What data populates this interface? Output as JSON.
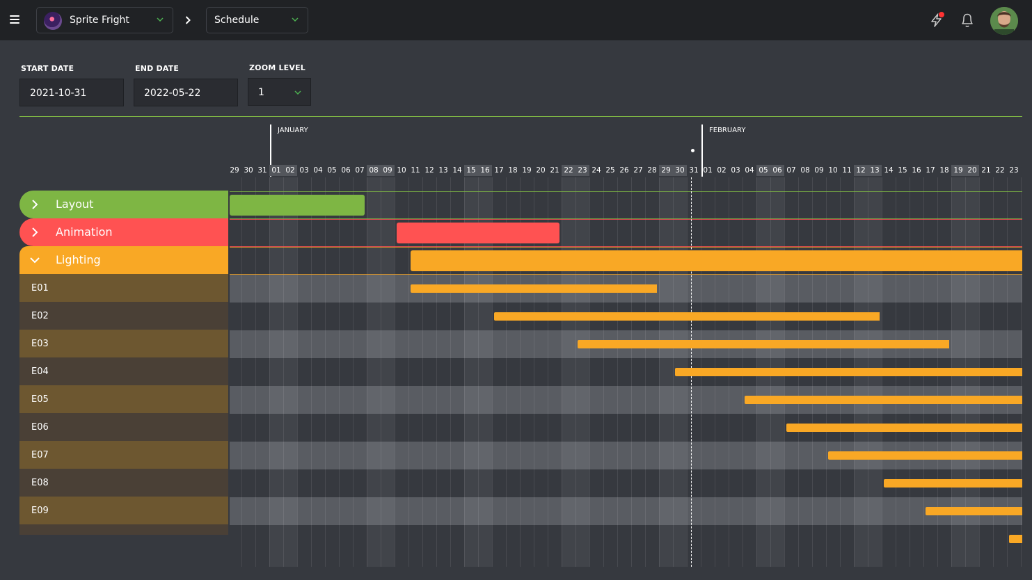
{
  "header": {
    "project": {
      "name": "Sprite Fright"
    },
    "view": {
      "name": "Schedule"
    }
  },
  "filters": {
    "start_date": {
      "label": "START DATE",
      "value": "2021-10-31"
    },
    "end_date": {
      "label": "END DATE",
      "value": "2022-05-22"
    },
    "zoom": {
      "label": "ZOOM LEVEL",
      "value": "1"
    }
  },
  "timeline": {
    "months": [
      {
        "name": "JANUARY",
        "start_index": 3
      },
      {
        "name": "FEBRUARY",
        "start_index": 34
      }
    ],
    "days": [
      "29",
      "30",
      "31",
      "01",
      "02",
      "03",
      "04",
      "05",
      "06",
      "07",
      "08",
      "09",
      "10",
      "11",
      "12",
      "13",
      "14",
      "15",
      "16",
      "17",
      "18",
      "19",
      "20",
      "21",
      "22",
      "23",
      "24",
      "25",
      "26",
      "27",
      "28",
      "29",
      "30",
      "31",
      "01",
      "02",
      "03",
      "04",
      "05",
      "06",
      "07",
      "08",
      "09",
      "10",
      "11",
      "12",
      "13",
      "14",
      "15",
      "16",
      "17",
      "18",
      "19",
      "20",
      "21",
      "22",
      "23"
    ],
    "weekend_indices": [
      3,
      4,
      10,
      11,
      17,
      18,
      24,
      25,
      31,
      32,
      38,
      39,
      45,
      46,
      52,
      53
    ],
    "today_index": 33.3
  },
  "colors": {
    "layout": "#7eb644",
    "animation": "#ff5252",
    "lighting": "#f9a825",
    "sub_row_light": "#6d5730",
    "sub_row_dark": "#4a4036"
  },
  "tasks": [
    {
      "id": "layout",
      "name": "Layout",
      "type": "group",
      "state": "collapsed",
      "color": "#7eb644",
      "bar": {
        "start": 0,
        "end": 9.7
      }
    },
    {
      "id": "animation",
      "name": "Animation",
      "type": "group",
      "state": "collapsed",
      "color": "#ff5252",
      "bar": {
        "start": 12,
        "end": 23.7
      }
    },
    {
      "id": "lighting",
      "name": "Lighting",
      "type": "group",
      "state": "expanded",
      "color": "#f9a825",
      "bar": {
        "start": 13,
        "end": 57
      }
    },
    {
      "id": "e01",
      "name": "E01",
      "type": "sub",
      "bar": {
        "start": 13,
        "end": 30.7
      }
    },
    {
      "id": "e02",
      "name": "E02",
      "type": "sub",
      "bar": {
        "start": 19,
        "end": 46.7
      }
    },
    {
      "id": "e03",
      "name": "E03",
      "type": "sub",
      "bar": {
        "start": 25,
        "end": 51.7
      }
    },
    {
      "id": "e04",
      "name": "E04",
      "type": "sub",
      "bar": {
        "start": 32,
        "end": 57
      }
    },
    {
      "id": "e05",
      "name": "E05",
      "type": "sub",
      "bar": {
        "start": 37,
        "end": 57
      }
    },
    {
      "id": "e06",
      "name": "E06",
      "type": "sub",
      "bar": {
        "start": 40,
        "end": 57
      }
    },
    {
      "id": "e07",
      "name": "E07",
      "type": "sub",
      "bar": {
        "start": 43,
        "end": 57
      }
    },
    {
      "id": "e08",
      "name": "E08",
      "type": "sub",
      "bar": {
        "start": 47,
        "end": 57
      }
    },
    {
      "id": "e09",
      "name": "E09",
      "type": "sub",
      "bar": {
        "start": 50,
        "end": 57
      }
    },
    {
      "id": "e10",
      "name": "",
      "type": "sub",
      "bar": {
        "start": 56,
        "end": 57
      }
    }
  ]
}
